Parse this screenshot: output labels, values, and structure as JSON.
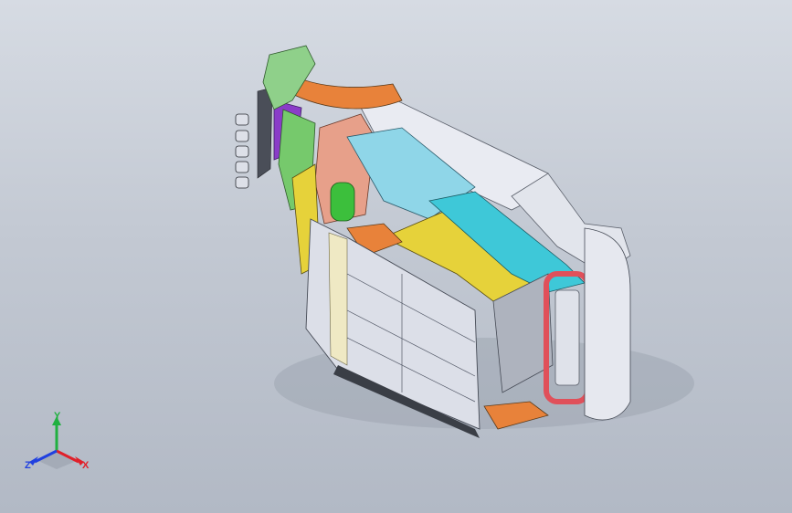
{
  "viewport": {
    "background_top": "#d6dbe3",
    "background_bottom": "#b2b9c5"
  },
  "model": {
    "description_icon": "vehicle-body-assembly-isometric",
    "colors": {
      "orange": "#e8823a",
      "purple": "#8a3cc8",
      "green": "#3cbf3c",
      "yellow": "#e6d23a",
      "cyan": "#3ec8d8",
      "red": "#e0505a",
      "white": "#eceef4",
      "grey": "#9aa0ac",
      "salmon": "#e7a08a"
    }
  },
  "triad": {
    "x_label": "X",
    "y_label": "Y",
    "z_label": "Z",
    "x_color": "#e0202a",
    "y_color": "#20b040",
    "z_color": "#2040e0"
  }
}
